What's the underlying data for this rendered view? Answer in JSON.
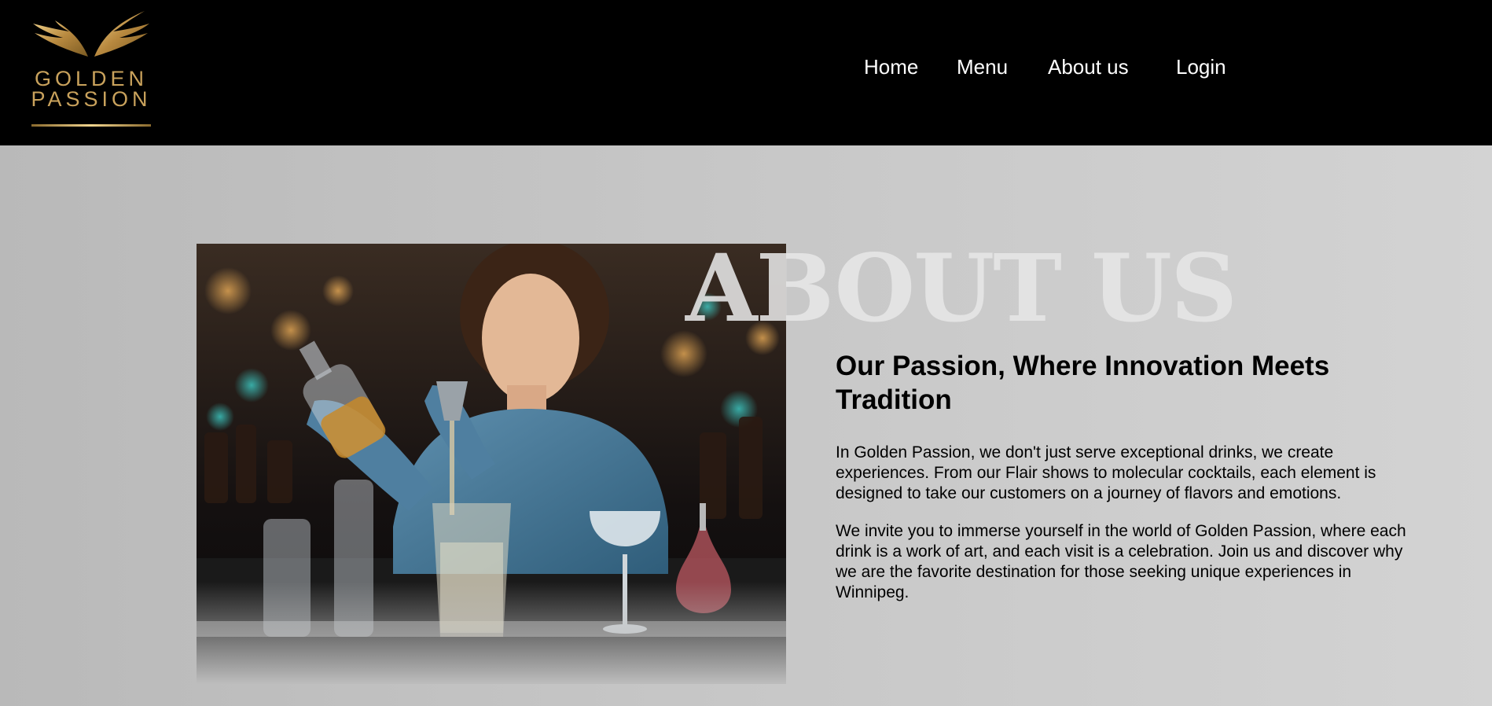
{
  "brand": {
    "line1": "GOLDEN",
    "line2": "PASSION"
  },
  "nav": {
    "home": "Home",
    "menu": "Menu",
    "about": "About us",
    "login": "Login"
  },
  "about": {
    "watermark": "ABOUT US",
    "heading": "Our Passion, Where Innovation Meets Tradition",
    "paragraph1": "In Golden Passion, we don't just serve exceptional drinks, we create experiences. From our Flair shows to molecular cocktails, each element is designed to take our customers on a journey of flavors and emotions.",
    "paragraph2": "We invite you to immerse yourself in the world of Golden Passion, where each drink is a work of art, and each visit is a celebration. Join us and discover why we are the favorite destination for those seeking unique experiences in Winnipeg."
  },
  "colors": {
    "header_bg": "#000000",
    "gold": "#c9a25c",
    "text": "#000000",
    "nav_text": "#ffffff"
  }
}
